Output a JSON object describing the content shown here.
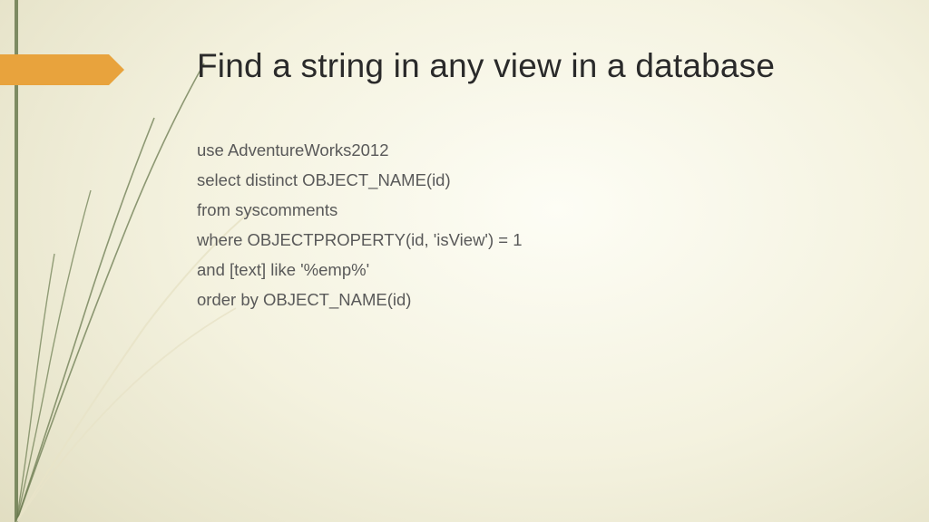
{
  "title": "Find a string in any view in a database",
  "code": {
    "l1": "use AdventureWorks2012",
    "l2": "select distinct OBJECT_NAME(id)",
    "l3": "from syscomments",
    "l4": "where OBJECTPROPERTY(id, 'isView') = 1",
    "l5": "and [text] like '%emp%'",
    "l6": "order by OBJECT_NAME(id)"
  }
}
